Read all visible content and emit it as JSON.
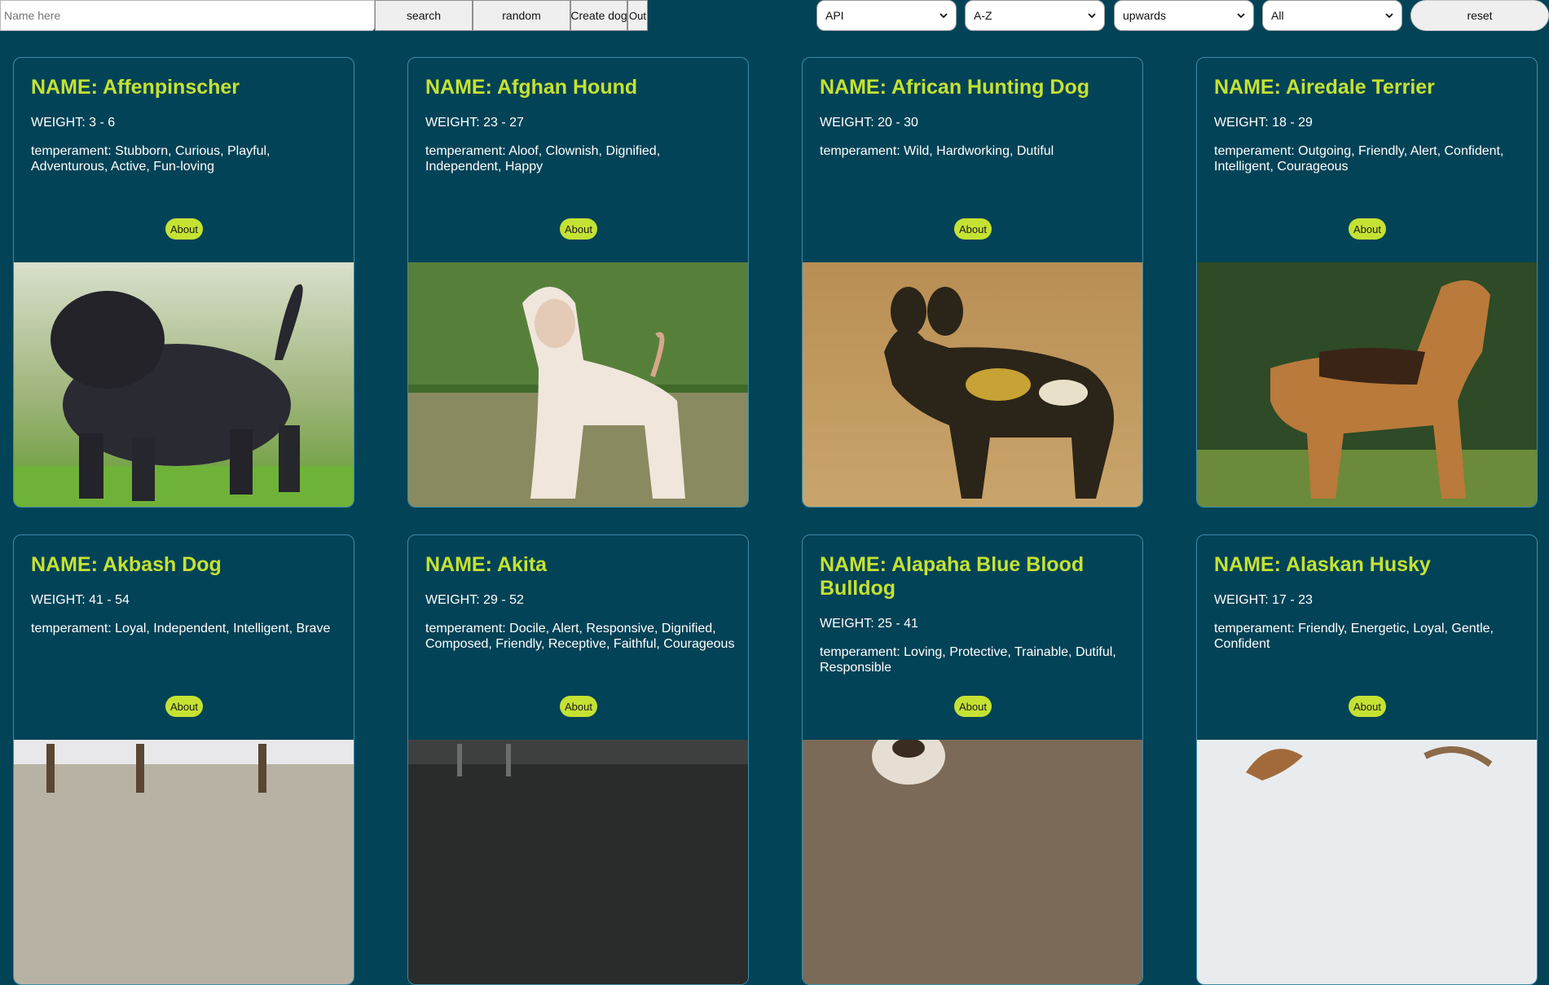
{
  "toolbar": {
    "search_placeholder": "Name here",
    "search_label": "search",
    "random_label": "random",
    "create_label": "Create dog",
    "out_label": "Out",
    "reset_label": "reset"
  },
  "filters": {
    "source": "API",
    "order": "A-Z",
    "direction": "upwards",
    "temperament": "All"
  },
  "card_labels": {
    "about": "About"
  },
  "dogs": [
    {
      "name": "NAME: Affenpinscher",
      "weight": "WEIGHT: 3 - 6",
      "temperament": "temperament: Stubborn, Curious, Playful, Adventurous, Active, Fun-loving"
    },
    {
      "name": "NAME: Afghan Hound",
      "weight": "WEIGHT: 23 - 27",
      "temperament": "temperament: Aloof, Clownish, Dignified, Independent, Happy"
    },
    {
      "name": "NAME: African Hunting Dog",
      "weight": "WEIGHT: 20 - 30",
      "temperament": "temperament: Wild, Hardworking, Dutiful"
    },
    {
      "name": "NAME: Airedale Terrier",
      "weight": "WEIGHT: 18 - 29",
      "temperament": "temperament: Outgoing, Friendly, Alert, Confident, Intelligent, Courageous"
    },
    {
      "name": "NAME: Akbash Dog",
      "weight": "WEIGHT: 41 - 54",
      "temperament": "temperament: Loyal, Independent, Intelligent, Brave"
    },
    {
      "name": "NAME: Akita",
      "weight": "WEIGHT: 29 - 52",
      "temperament": "temperament: Docile, Alert, Responsive, Dignified, Composed, Friendly, Receptive, Faithful, Courageous"
    },
    {
      "name": "NAME: Alapaha Blue Blood Bulldog",
      "weight": "WEIGHT: 25 - 41",
      "temperament": "temperament: Loving, Protective, Trainable, Dutiful, Responsible"
    },
    {
      "name": "NAME: Alaskan Husky",
      "weight": "WEIGHT: 17 - 23",
      "temperament": "temperament: Friendly, Energetic, Loyal, Gentle, Confident"
    }
  ],
  "colors": {
    "background": "#034357",
    "accent": "#c5e233",
    "card_border": "#3c8ba8",
    "text": "#ffffff"
  }
}
